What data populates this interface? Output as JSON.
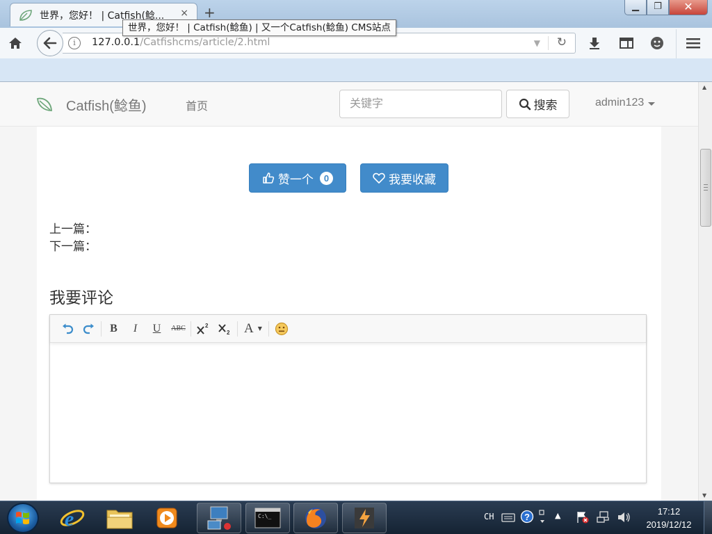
{
  "browser": {
    "tab_title": "世界，您好！ | Catfish(鲶...",
    "tab_close": "×",
    "new_tab": "+",
    "tooltip": "世界，您好！ | Catfish(鲶鱼) | 又一个Catfish(鲶鱼) CMS站点",
    "url_host": "127.0.0.1",
    "url_path": "/Catfishcms/article/2.html",
    "window_controls": {
      "minimize": "▁",
      "maximize": "❐",
      "close": "✕"
    }
  },
  "site": {
    "brand": "Catfish(鲶鱼)",
    "nav_home": "首页",
    "search_placeholder": "关键字",
    "search_button": "搜索",
    "user_name": "admin123"
  },
  "article": {
    "like_label": "赞一个",
    "like_count": "0",
    "favorite_label": "我要收藏",
    "prev_label": "上一篇：",
    "next_label": "下一篇：",
    "comment_heading": "我要评论"
  },
  "editor": {
    "toolbar": [
      "undo-icon",
      "redo-icon",
      "bold-icon",
      "italic-icon",
      "underline-icon",
      "strikethrough-icon",
      "superscript-icon",
      "subscript-icon",
      "font-color-icon",
      "emoticon-icon"
    ],
    "bold": "B",
    "italic": "I",
    "underline": "U",
    "strike": "ABC",
    "font_color": "A"
  },
  "taskbar": {
    "input_lang": "CH",
    "time": "17:12",
    "date": "2019/12/12"
  },
  "colors": {
    "primary_button": "#428bca",
    "navbar_bg": "#f8f8f8",
    "taskbar": "#1b2b3e"
  }
}
